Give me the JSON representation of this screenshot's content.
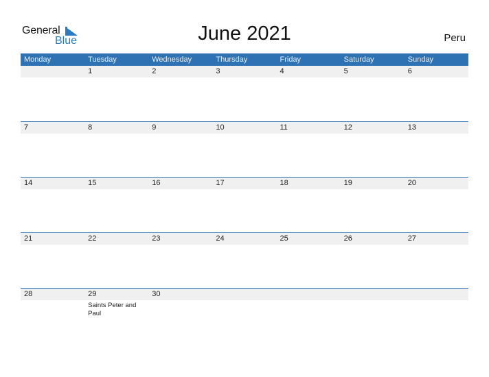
{
  "logo": {
    "word1": "General",
    "word2": "Blue"
  },
  "title": "June 2021",
  "country": "Peru",
  "colors": {
    "accent": "#2e72b4",
    "brand_blue": "#2a7bc4",
    "day_row_bg": "#f0f0f0"
  },
  "weekdays": [
    "Monday",
    "Tuesday",
    "Wednesday",
    "Thursday",
    "Friday",
    "Saturday",
    "Sunday"
  ],
  "weeks": [
    {
      "days": [
        "",
        "1",
        "2",
        "3",
        "4",
        "5",
        "6"
      ],
      "events": [
        "",
        "",
        "",
        "",
        "",
        "",
        ""
      ]
    },
    {
      "days": [
        "7",
        "8",
        "9",
        "10",
        "11",
        "12",
        "13"
      ],
      "events": [
        "",
        "",
        "",
        "",
        "",
        "",
        ""
      ]
    },
    {
      "days": [
        "14",
        "15",
        "16",
        "17",
        "18",
        "19",
        "20"
      ],
      "events": [
        "",
        "",
        "",
        "",
        "",
        "",
        ""
      ]
    },
    {
      "days": [
        "21",
        "22",
        "23",
        "24",
        "25",
        "26",
        "27"
      ],
      "events": [
        "",
        "",
        "",
        "",
        "",
        "",
        ""
      ]
    },
    {
      "days": [
        "28",
        "29",
        "30",
        "",
        "",
        "",
        ""
      ],
      "events": [
        "",
        "Saints Peter and Paul",
        "",
        "",
        "",
        "",
        ""
      ]
    }
  ]
}
